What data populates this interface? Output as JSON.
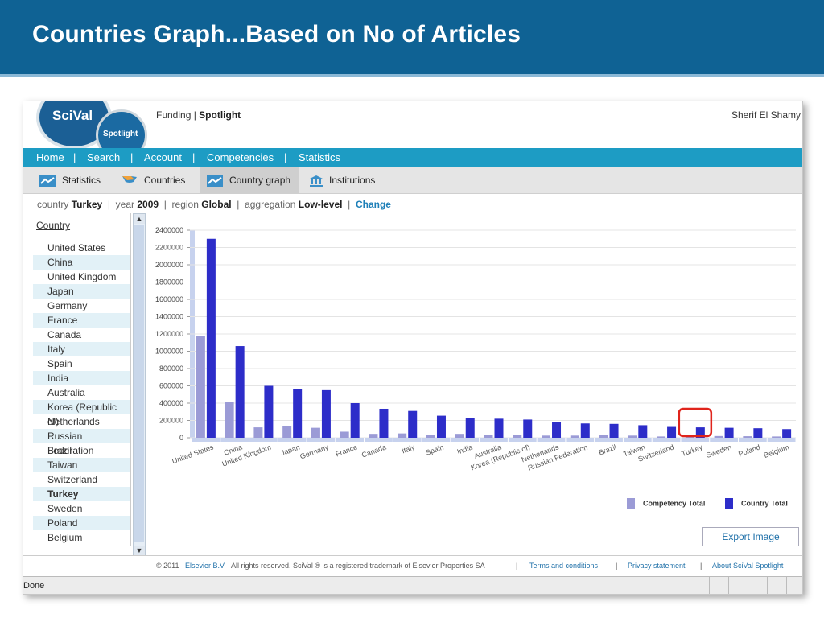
{
  "slide": {
    "title": "Countries Graph...Based on No of Articles"
  },
  "app": {
    "logo": "SciVal",
    "logo_sub": "Spotlight",
    "top_link_funding": "Funding",
    "top_link_spotlight": "Spotlight",
    "user": "Sherif El Shamy"
  },
  "nav": [
    "Home",
    "Search",
    "Account",
    "Competencies",
    "Statistics"
  ],
  "subtabs": [
    "Statistics",
    "Countries",
    "Country graph",
    "Institutions"
  ],
  "filters": {
    "country_label": "country",
    "country_value": "Turkey",
    "year_label": "year",
    "year_value": "2009",
    "region_label": "region",
    "region_value": "Global",
    "aggregation_label": "aggregation",
    "aggregation_value": "Low-level",
    "change": "Change"
  },
  "country_panel": {
    "header": "Country",
    "selected": "Turkey",
    "items": [
      "United States",
      "China",
      "United Kingdom",
      "Japan",
      "Germany",
      "France",
      "Canada",
      "Italy",
      "Spain",
      "India",
      "Australia",
      "Korea (Republic of)",
      "Netherlands",
      "Russian Federation",
      "Brazil",
      "Taiwan",
      "Switzerland",
      "Turkey",
      "Sweden",
      "Poland",
      "Belgium"
    ]
  },
  "chart_data": {
    "type": "bar",
    "categories": [
      "United States",
      "China",
      "United Kingdom",
      "Japan",
      "Germany",
      "France",
      "Canada",
      "Italy",
      "Spain",
      "India",
      "Australia",
      "Korea (Republic of)",
      "Netherlands",
      "Russian Federation",
      "Brazil",
      "Taiwan",
      "Switzerland",
      "Turkey",
      "Sweden",
      "Poland",
      "Belgium"
    ],
    "series": [
      {
        "name": "Competency Total",
        "color": "#9b9bd6",
        "values": [
          1180000,
          410000,
          120000,
          135000,
          115000,
          70000,
          45000,
          50000,
          30000,
          45000,
          30000,
          30000,
          25000,
          25000,
          30000,
          25000,
          15000,
          20000,
          20000,
          18000,
          15000
        ]
      },
      {
        "name": "Country Total",
        "color": "#2d2dc9",
        "values": [
          2300000,
          1060000,
          600000,
          560000,
          550000,
          400000,
          335000,
          310000,
          255000,
          225000,
          220000,
          210000,
          180000,
          165000,
          160000,
          145000,
          125000,
          120000,
          115000,
          110000,
          100000
        ]
      }
    ],
    "ylim": [
      0,
      2400000
    ],
    "yticks": [
      "2400000",
      "2200000",
      "2000000",
      "1800000",
      "1600000",
      "1400000",
      "1200000",
      "1000000",
      "800000",
      "600000",
      "400000",
      "200000",
      "0"
    ],
    "highlight": "Turkey",
    "grid": true,
    "legend": "bottom-right"
  },
  "export_label": "Export Image",
  "footer": {
    "copyright": "© 2011",
    "elsevier": "Elsevier B.V.",
    "rights": "All rights reserved. SciVal ® is a registered trademark of Elsevier Properties SA",
    "terms": "Terms and conditions",
    "privacy": "Privacy statement",
    "about": "About SciVal Spotlight"
  },
  "status": "Done"
}
